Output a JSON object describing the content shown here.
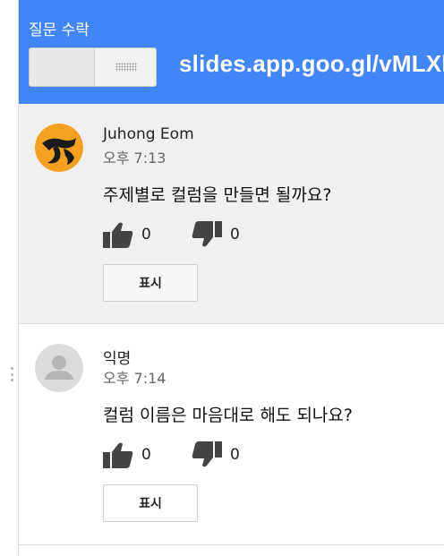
{
  "header": {
    "title": "질문 수락",
    "url": "slides.app.goo.gl/vMLXh",
    "color": "#4285f4"
  },
  "questions": [
    {
      "author": "Juhong Eom",
      "time": "오후 7:13",
      "text": "주제별로 컬럼을 만들면 될까요?",
      "upvotes": "0",
      "downvotes": "0",
      "show_label": "표시",
      "avatar": "orange-logo-avatar"
    },
    {
      "author": "익명",
      "time": "오후 7:14",
      "text": "컬럼 이름은 마음대로 해도 되나요?",
      "upvotes": "0",
      "downvotes": "0",
      "show_label": "표시",
      "avatar": "anonymous-person-avatar"
    }
  ]
}
